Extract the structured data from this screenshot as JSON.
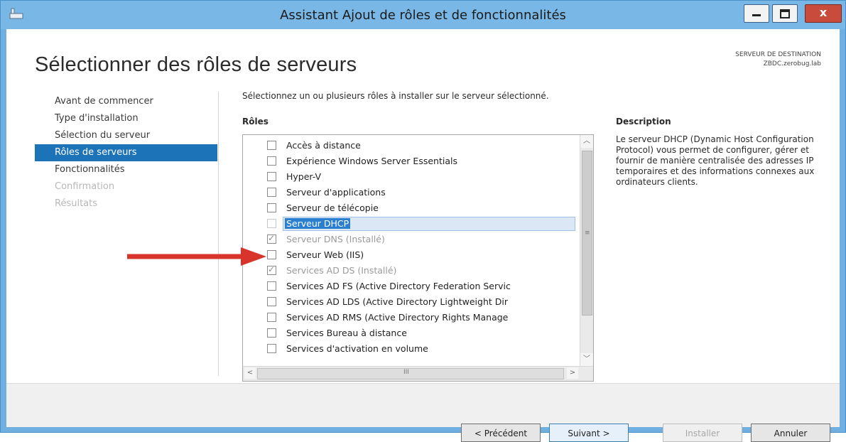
{
  "window": {
    "title": "Assistant Ajout de rôles et de fonctionnalités",
    "controls": [
      "minimize-icon",
      "maximize-icon",
      "close-icon"
    ]
  },
  "page": {
    "title": "Sélectionner des rôles de serveurs",
    "destination_label": "SERVEUR DE DESTINATION",
    "destination_server": "ZBDC.zerobug.lab"
  },
  "nav": {
    "items": [
      {
        "label": "Avant de commencer",
        "state": "normal"
      },
      {
        "label": "Type d'installation",
        "state": "normal"
      },
      {
        "label": "Sélection du serveur",
        "state": "normal"
      },
      {
        "label": "Rôles de serveurs",
        "state": "active"
      },
      {
        "label": "Fonctionnalités",
        "state": "normal"
      },
      {
        "label": "Confirmation",
        "state": "disabled"
      },
      {
        "label": "Résultats",
        "state": "disabled"
      }
    ]
  },
  "main": {
    "intro": "Sélectionnez un ou plusieurs rôles à installer sur le serveur sélectionné.",
    "roles_header": "Rôles",
    "description_header": "Description",
    "description_text": "Le serveur DHCP (Dynamic Host Configuration Protocol) vous permet de configurer, gérer et fournir de manière centralisée des adresses IP temporaires et des informations connexes aux ordinateurs clients.",
    "roles": [
      {
        "label": "Accès à distance",
        "checked": false,
        "disabled": false,
        "selected": false
      },
      {
        "label": "Expérience Windows Server Essentials",
        "checked": false,
        "disabled": false,
        "selected": false
      },
      {
        "label": "Hyper-V",
        "checked": false,
        "disabled": false,
        "selected": false
      },
      {
        "label": "Serveur d'applications",
        "checked": false,
        "disabled": false,
        "selected": false
      },
      {
        "label": "Serveur de télécopie",
        "checked": false,
        "disabled": false,
        "selected": false
      },
      {
        "label": "Serveur DHCP",
        "checked": false,
        "disabled": false,
        "selected": true
      },
      {
        "label": "Serveur DNS (Installé)",
        "checked": true,
        "disabled": true,
        "selected": false
      },
      {
        "label": "Serveur Web (IIS)",
        "checked": false,
        "disabled": false,
        "selected": false
      },
      {
        "label": "Services AD DS (Installé)",
        "checked": true,
        "disabled": true,
        "selected": false
      },
      {
        "label": "Services AD FS (Active Directory Federation Servic",
        "checked": false,
        "disabled": false,
        "selected": false
      },
      {
        "label": "Services AD LDS (Active Directory Lightweight Dir",
        "checked": false,
        "disabled": false,
        "selected": false
      },
      {
        "label": "Services AD RMS (Active Directory Rights Manage",
        "checked": false,
        "disabled": false,
        "selected": false
      },
      {
        "label": "Services Bureau à distance",
        "checked": false,
        "disabled": false,
        "selected": false
      },
      {
        "label": "Services d'activation en volume",
        "checked": false,
        "disabled": false,
        "selected": false
      }
    ],
    "scrollbar_grip": "III",
    "vscroll_grip": "≡",
    "arrow_color": "#d9342b"
  },
  "footer": {
    "previous_label": "< Précédent",
    "next_label": "Suivant >",
    "install_label": "Installer",
    "cancel_label": "Annuler"
  },
  "colors": {
    "accent": "#1c73b8",
    "titlebar": "#79b8e6",
    "close_button": "#c94b3b",
    "selected_item": "#2b7fd0"
  }
}
